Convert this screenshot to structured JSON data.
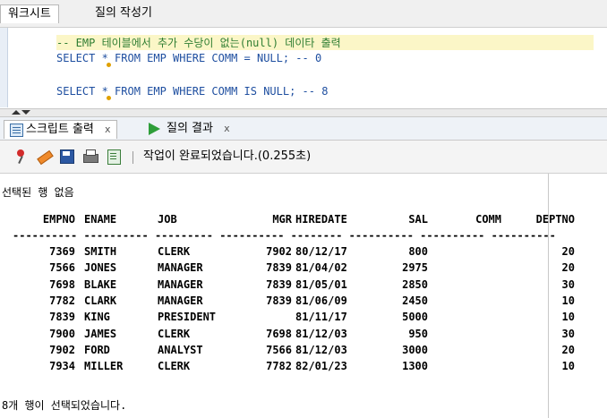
{
  "top_tabs": {
    "worksheet": "워크시트",
    "query_builder": "질의 작성기"
  },
  "editor": {
    "comment": "-- EMP 테이블에서 추가 수당이 없는(null) 데이타 출력",
    "line1": "SELECT * FROM EMP WHERE COMM = NULL; -- 0",
    "line2": "SELECT * FROM EMP WHERE COMM IS NULL; -- 8"
  },
  "result_tabs": {
    "script_output": "스크립트 출력",
    "query_result": "질의 결과",
    "close_glyph": "x"
  },
  "toolbar": {
    "icons": [
      "pin-icon",
      "eraser-icon",
      "save-icon",
      "print-icon",
      "document-icon"
    ],
    "status": "작업이 완료되었습니다.(0.255초)"
  },
  "output": {
    "no_rows_selected": "선택된 행 없음",
    "columns": [
      "EMPNO",
      "ENAME",
      "JOB",
      "MGR",
      "HIREDATE",
      "SAL",
      "COMM",
      "DEPTNO"
    ],
    "separator": "---------- ---------- --------- ---------- -------- ---------- ---------- ----------",
    "rows": [
      [
        "7369",
        "SMITH",
        "CLERK",
        "7902",
        "80/12/17",
        "800",
        "",
        "20"
      ],
      [
        "7566",
        "JONES",
        "MANAGER",
        "7839",
        "81/04/02",
        "2975",
        "",
        "20"
      ],
      [
        "7698",
        "BLAKE",
        "MANAGER",
        "7839",
        "81/05/01",
        "2850",
        "",
        "30"
      ],
      [
        "7782",
        "CLARK",
        "MANAGER",
        "7839",
        "81/06/09",
        "2450",
        "",
        "10"
      ],
      [
        "7839",
        "KING",
        "PRESIDENT",
        "",
        "81/11/17",
        "5000",
        "",
        "10"
      ],
      [
        "7900",
        "JAMES",
        "CLERK",
        "7698",
        "81/12/03",
        "950",
        "",
        "30"
      ],
      [
        "7902",
        "FORD",
        "ANALYST",
        "7566",
        "81/12/03",
        "3000",
        "",
        "20"
      ],
      [
        "7934",
        "MILLER",
        "CLERK",
        "7782",
        "82/01/23",
        "1300",
        "",
        "10"
      ]
    ],
    "footer": "8개 행이 선택되었습니다."
  }
}
